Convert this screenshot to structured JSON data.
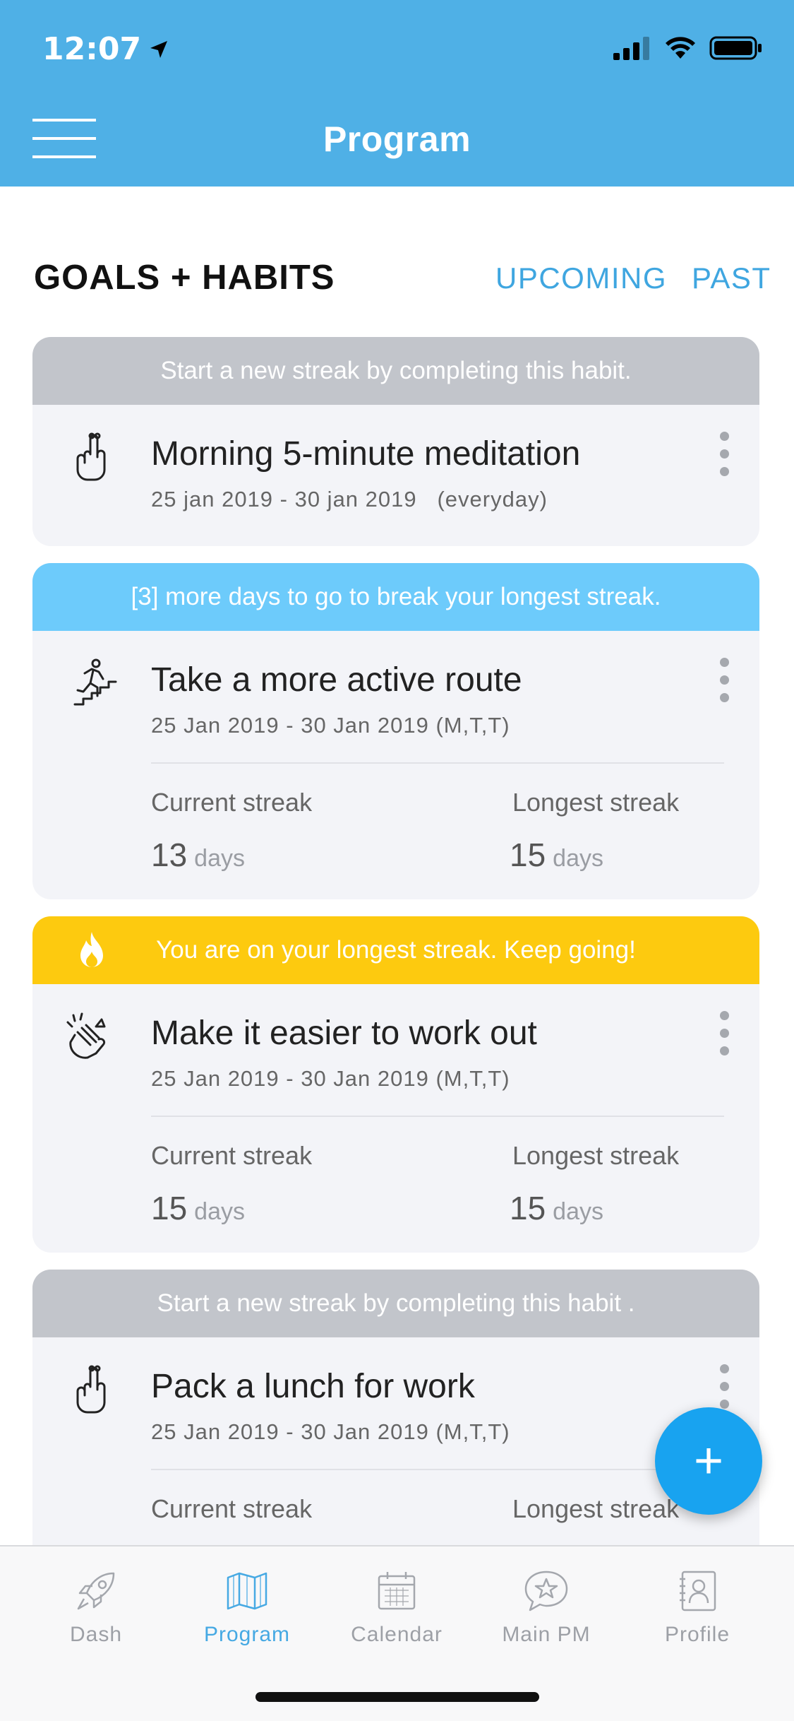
{
  "status_bar": {
    "time": "12:07"
  },
  "header": {
    "title": "Program"
  },
  "section": {
    "title": "GOALS + HABITS",
    "tabs": [
      "UPCOMING",
      "PAST"
    ]
  },
  "cards": [
    {
      "banner": "Start a new streak by completing this habit.",
      "title": "Morning 5-minute meditation",
      "dates": "25 jan 2019 - 30 jan 2019   (everyday)"
    },
    {
      "banner": "[3] more days to go to break your longest streak.",
      "title": "Take a more active route",
      "dates": "25 Jan 2019 - 30 Jan 2019 (M,T,T)",
      "current_label": "Current streak",
      "current_value": "13",
      "longest_label": "Longest streak",
      "longest_value": "15",
      "unit": "days"
    },
    {
      "banner": "You are on your longest streak. Keep going!",
      "title": "Make it easier to work out",
      "dates": "25 Jan 2019 - 30 Jan 2019 (M,T,T)",
      "current_label": "Current streak",
      "current_value": "15",
      "longest_label": "Longest streak",
      "longest_value": "15",
      "unit": "days"
    },
    {
      "banner": "Start a new streak by completing this habit .",
      "title": "Pack a lunch for work",
      "dates": "25 Jan 2019 - 30 Jan 2019 (M,T,T)",
      "current_label": "Current streak",
      "longest_label": "Longest streak"
    }
  ],
  "fab": {
    "label": "+"
  },
  "tabbar": [
    {
      "label": "Dash",
      "icon": "rocket-icon"
    },
    {
      "label": "Program",
      "icon": "map-icon"
    },
    {
      "label": "Calendar",
      "icon": "calendar-icon"
    },
    {
      "label": "Main PM",
      "icon": "chat-star-icon"
    },
    {
      "label": "Profile",
      "icon": "contact-book-icon"
    }
  ],
  "colors": {
    "header": "#4fb0e6",
    "accent": "#3fa6e0",
    "banner_gray": "#c2c5cb",
    "banner_blue": "#6dcbfb",
    "banner_yellow": "#fdca0f",
    "fab": "#18a3f0"
  }
}
